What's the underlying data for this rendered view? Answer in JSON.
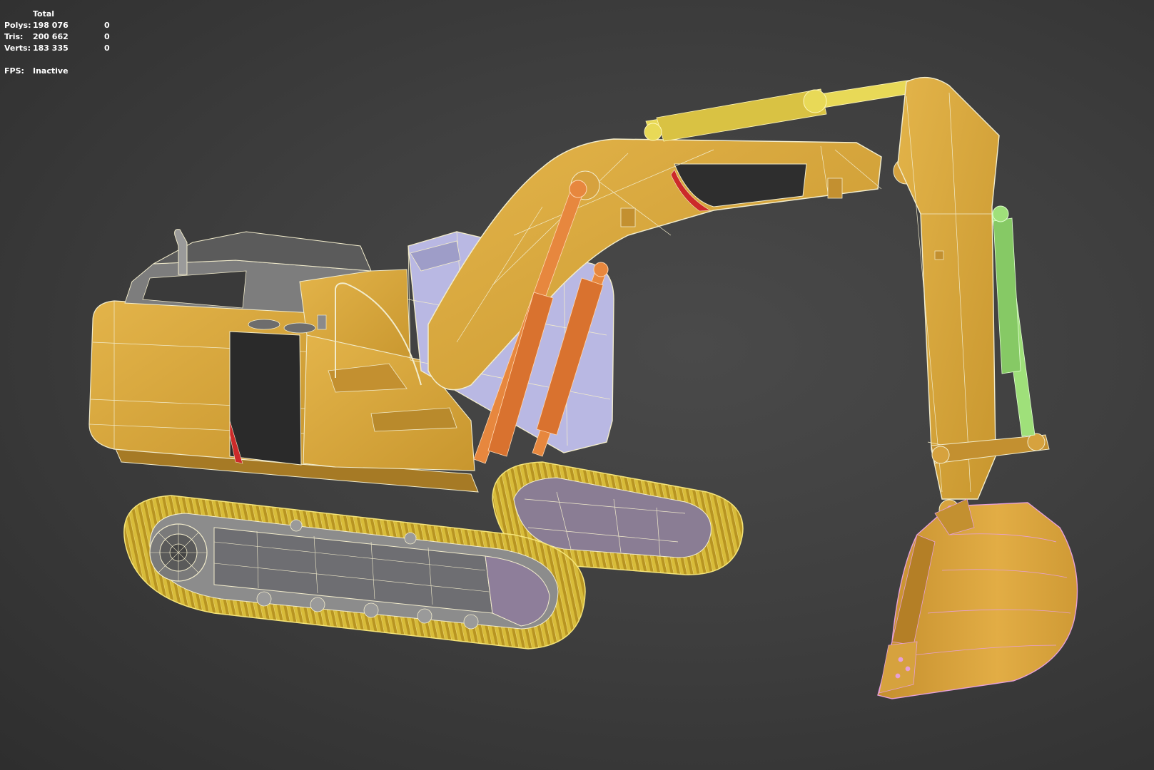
{
  "statistics": {
    "column_header": "Total",
    "rows": [
      {
        "label": "Polys:",
        "total": "198 076",
        "selected": "0"
      },
      {
        "label": "Tris:",
        "total": "200 662",
        "selected": "0"
      },
      {
        "label": "Verts:",
        "total": "183 335",
        "selected": "0"
      }
    ],
    "fps_label": "FPS:",
    "fps_value": "Inactive"
  },
  "scene": {
    "object": "excavator-model",
    "colors": {
      "body": "#d9a83c",
      "body_shade": "#b8862a",
      "wire": "#f2eccc",
      "track": "#c9a92c",
      "boom_cylinder": "#e7873e",
      "arm_cylinder": "#e8d957",
      "bucket_cylinder": "#9fe07a",
      "bucket_wire": "#e6a0d8",
      "glass": "#b9b8e3",
      "red_accent": "#cc2a2a",
      "dark_panel": "#2e2e2e"
    }
  }
}
